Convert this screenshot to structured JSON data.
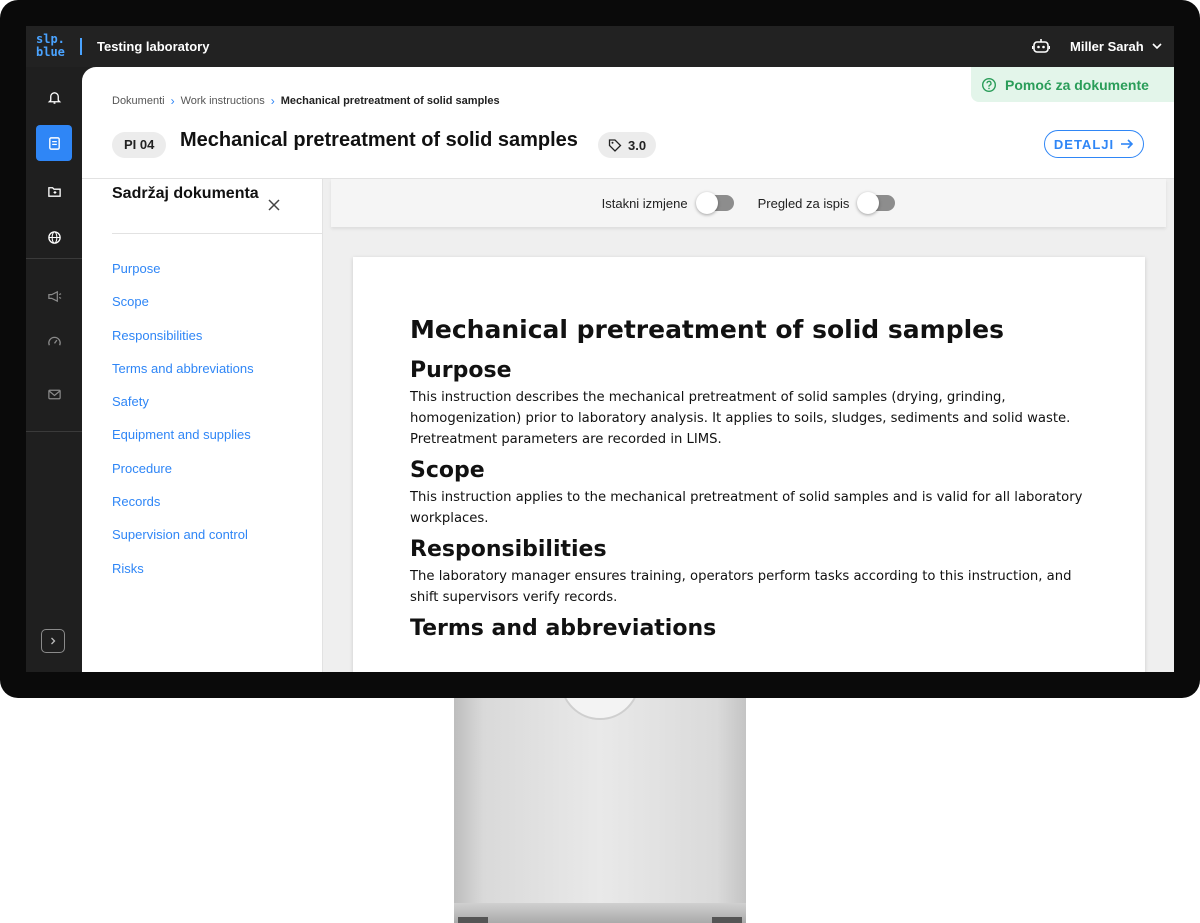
{
  "topbar": {
    "logo_line1": "slp.",
    "logo_line2": "blue",
    "app_title": "Testing laboratory",
    "user_name": "Miller Sarah"
  },
  "rail": {
    "icons": [
      "bell-icon",
      "documents-icon",
      "folder-icon",
      "globe-icon",
      "megaphone-icon",
      "gauge-icon",
      "mail-icon",
      "expand-icon"
    ],
    "active": "documents-icon",
    "accent": "#2f86f6"
  },
  "breadcrumb": {
    "items": [
      "Dokumenti",
      "Work instructions",
      "Mechanical pretreatment of solid samples"
    ]
  },
  "help": {
    "label": "Pomoć za dokumente",
    "color": "#2a9d59"
  },
  "document": {
    "code": "PI 04",
    "title": "Mechanical pretreatment of solid samples",
    "version": "3.0",
    "details_label": "DETALJI"
  },
  "toc": {
    "title": "Sadržaj dokumenta",
    "items": [
      "Purpose",
      "Scope",
      "Responsibilities",
      "Terms and abbreviations",
      "Safety",
      "Equipment and supplies",
      "Procedure",
      "Records",
      "Supervision and control",
      "Risks"
    ]
  },
  "toggles": {
    "highlight_label": "Istakni izmjene",
    "highlight_on": false,
    "print_label": "Pregled za ispis",
    "print_on": false
  },
  "paper": {
    "title": "Mechanical pretreatment of solid samples",
    "sections": [
      {
        "heading": "Purpose",
        "text": "This instruction describes the mechanical pretreatment of solid samples (drying, grinding, homogenization) prior to laboratory analysis. It applies to soils, sludges, sediments and solid waste. Pretreatment parameters are recorded in LIMS."
      },
      {
        "heading": "Scope",
        "text": "This instruction applies to the mechanical pretreatment of solid samples and is valid for all laboratory workplaces."
      },
      {
        "heading": "Responsibilities",
        "text": "The laboratory manager ensures training, operators perform tasks according to this instruction, and shift supervisors verify records."
      },
      {
        "heading": "Terms and abbreviations",
        "text": ""
      }
    ]
  }
}
